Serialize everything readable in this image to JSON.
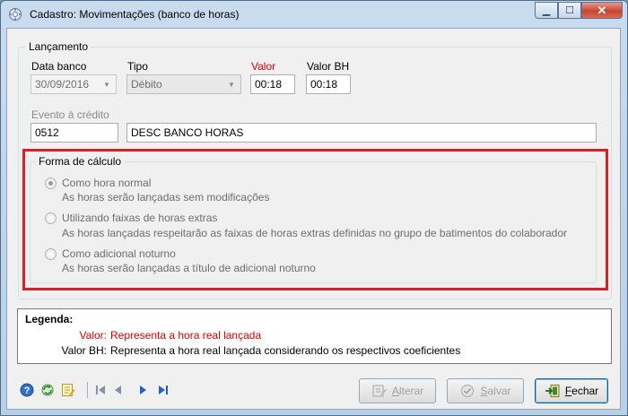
{
  "window": {
    "title": "Cadastro: Movimentações (banco de horas)",
    "controls": [
      "minimize",
      "maximize",
      "close"
    ]
  },
  "lancamento": {
    "legend": "Lançamento",
    "data_banco_label": "Data banco",
    "data_banco_value": "30/09/2016",
    "tipo_label": "Tipo",
    "tipo_value": "Débito",
    "valor_label": "Valor",
    "valor_value": "00:18",
    "valor_bh_label": "Valor BH",
    "valor_bh_value": "00:18",
    "evento_label": "Evento à crédito",
    "evento_code": "0512",
    "evento_desc": "DESC BANCO HORAS"
  },
  "forma_calculo": {
    "legend": "Forma de cálculo",
    "options": [
      {
        "label": "Como hora normal",
        "desc": "As horas serão lançadas sem modificações",
        "checked": true
      },
      {
        "label": "Utilizando faixas de horas extras",
        "desc": "As horas lançadas respeitarão as faixas de horas extras definidas no grupo de batimentos do colaborador",
        "checked": false
      },
      {
        "label": "Como adicional noturno",
        "desc": "As horas serão lançadas a título de adicional noturno",
        "checked": false
      }
    ],
    "highlight_color": "#d8202a"
  },
  "legenda": {
    "title": "Legenda:",
    "row1_key": "Valor:",
    "row1_text": "Representa a hora real lançada",
    "row2_key": "Valor BH:",
    "row2_text": "Representa a hora real lançada considerando os respectivos coeficientes"
  },
  "toolbar": {
    "icons": [
      "help-icon",
      "refresh-icon",
      "edit-note-icon",
      "first-record-icon",
      "previous-record-icon",
      "next-record-icon",
      "last-record-icon"
    ]
  },
  "buttons": {
    "alterar": {
      "first": "A",
      "rest": "lterar"
    },
    "salvar": {
      "first": "S",
      "rest": "alvar"
    },
    "fechar": {
      "first": "F",
      "rest": "echar"
    }
  },
  "colors": {
    "title_bar": "#c9dcee",
    "required_label": "#e00000"
  }
}
